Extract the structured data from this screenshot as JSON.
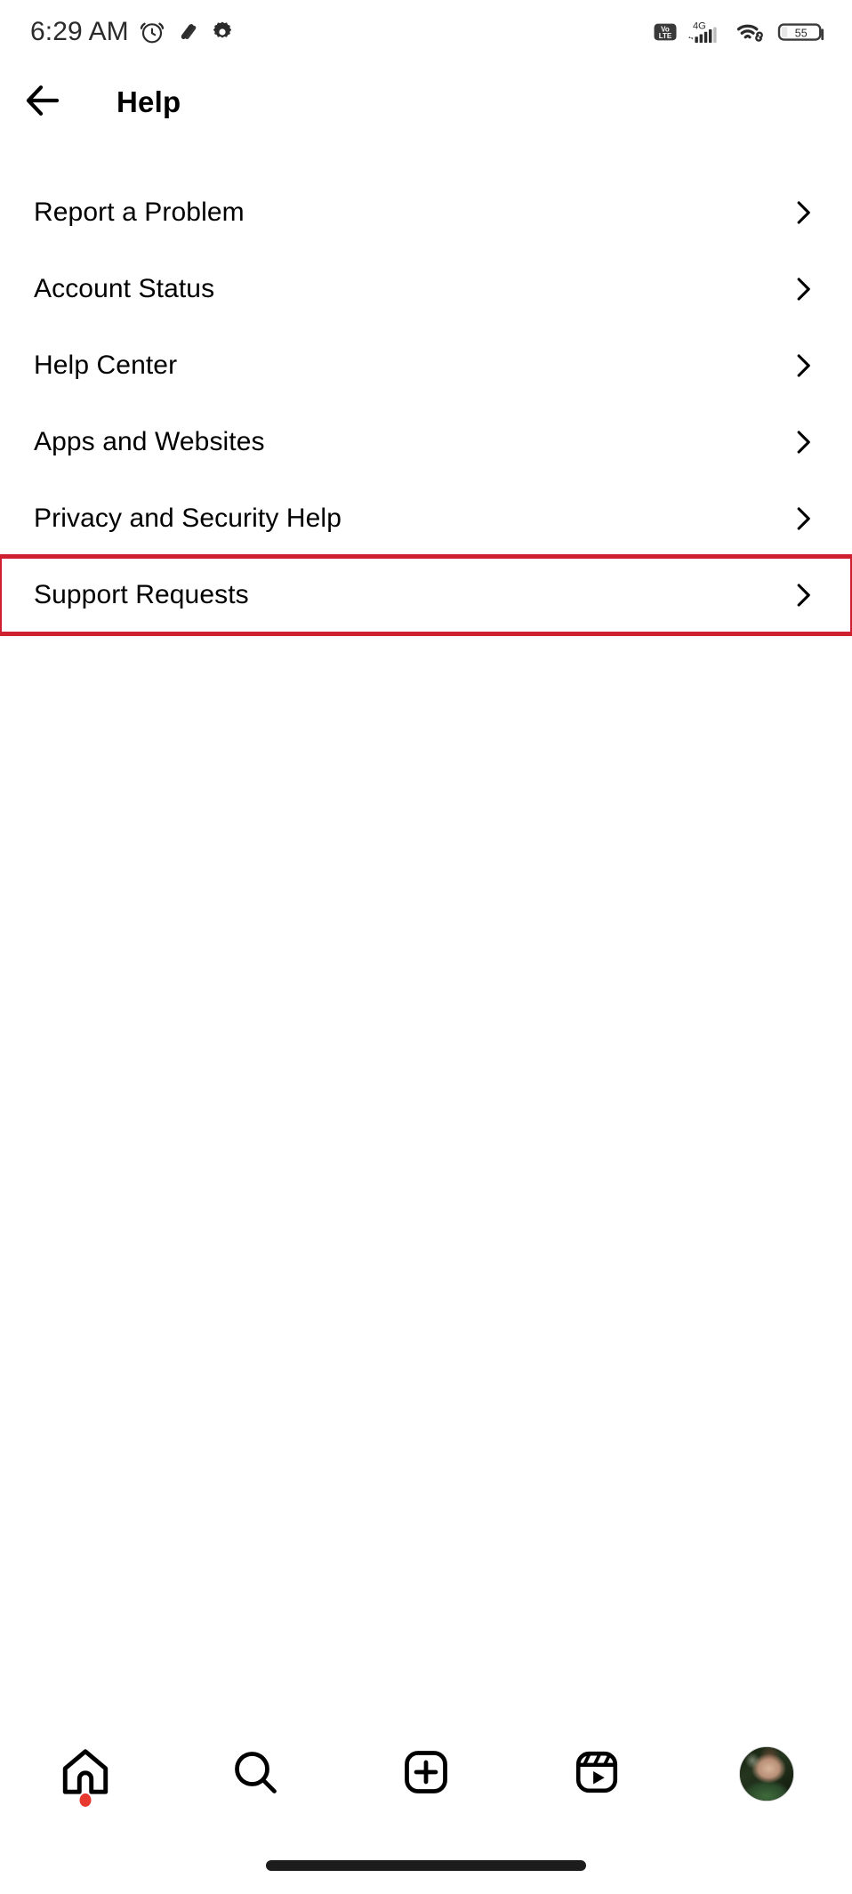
{
  "status_bar": {
    "time": "6:29 AM",
    "left_icons": [
      "alarm-icon",
      "mute-icon",
      "gear-icon"
    ],
    "network_label": "4G",
    "volte_label_top": "Vo",
    "volte_label_bottom": "LTE",
    "battery_level": "55",
    "right_icons": [
      "volte-icon",
      "signal-icon",
      "wifi-icon",
      "battery-icon"
    ]
  },
  "header": {
    "title": "Help",
    "back_icon": "arrow-left-icon"
  },
  "help_list": {
    "chevron_icon": "chevron-right-icon",
    "items": [
      {
        "label": "Report a Problem",
        "highlighted": false
      },
      {
        "label": "Account Status",
        "highlighted": false
      },
      {
        "label": "Help Center",
        "highlighted": false
      },
      {
        "label": "Apps and Websites",
        "highlighted": false
      },
      {
        "label": "Privacy and Security Help",
        "highlighted": false
      },
      {
        "label": "Support Requests",
        "highlighted": true
      }
    ]
  },
  "bottom_nav": {
    "items": [
      {
        "name": "home",
        "icon": "home-icon",
        "badge": true
      },
      {
        "name": "search",
        "icon": "search-icon",
        "badge": false
      },
      {
        "name": "create",
        "icon": "plus-square-icon",
        "badge": false
      },
      {
        "name": "reels",
        "icon": "reels-icon",
        "badge": false
      },
      {
        "name": "profile",
        "icon": "avatar-icon",
        "badge": false
      }
    ]
  },
  "colors": {
    "highlight_red": "#cf2030",
    "badge_red": "#e8392f",
    "text": "#000000",
    "status_text": "#2b2b2b",
    "background": "#ffffff"
  }
}
